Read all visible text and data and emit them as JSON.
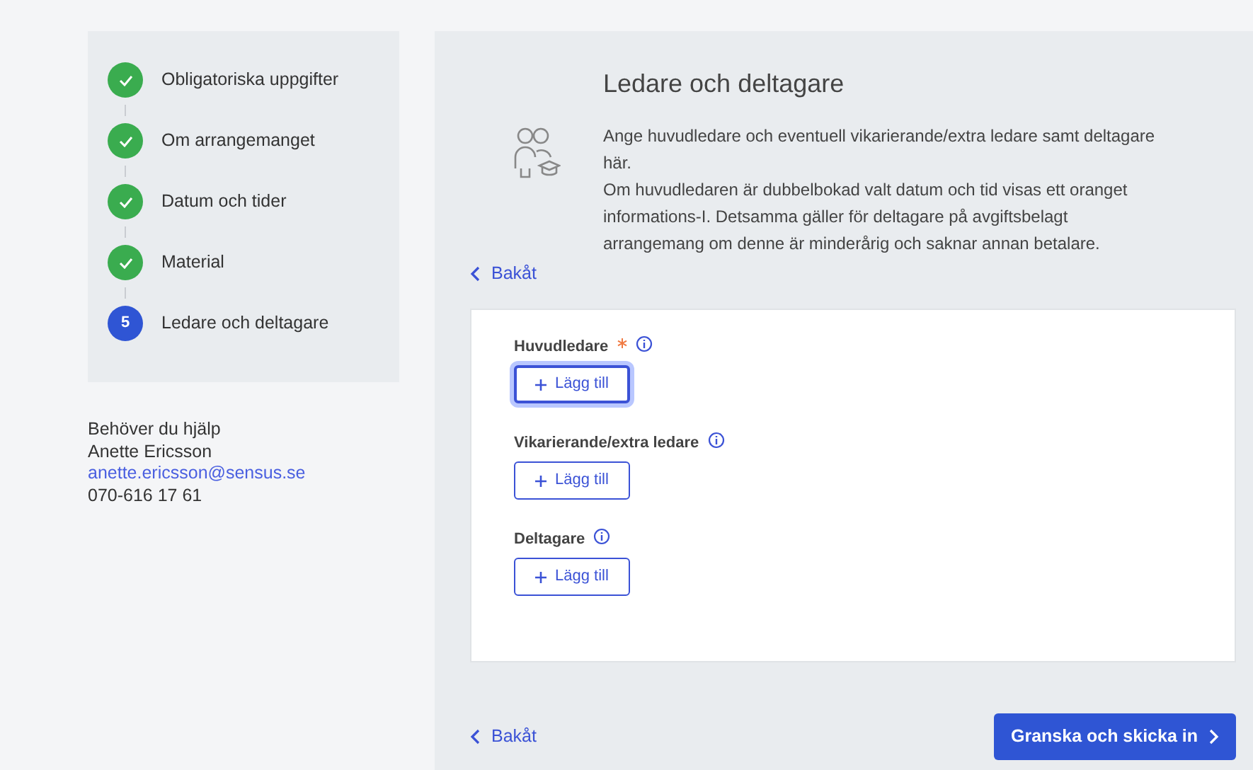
{
  "steps": [
    {
      "label": "Obligatoriska uppgifter",
      "done": true
    },
    {
      "label": "Om arrangemanget",
      "done": true
    },
    {
      "label": "Datum och tider",
      "done": true
    },
    {
      "label": "Material",
      "done": true
    },
    {
      "label": "Ledare och deltagare",
      "done": false,
      "number": "5"
    }
  ],
  "help": {
    "title": "Behöver du hjälp",
    "name": "Anette Ericsson",
    "email": "anette.ericsson@sensus.se",
    "phone": "070-616 17 61"
  },
  "section": {
    "title": "Ledare och deltagare",
    "paragraphs": [
      "Ange huvudledare och eventuell vikarierande/extra ledare samt deltagare här.",
      "Om huvudledaren är dubbelbokad valt datum och tid visas ett oranget informations-I. Detsamma gäller för deltagare på avgiftsbelagt arrangemang om denne är minderårig och saknar annan betalare."
    ]
  },
  "back_top": "Bakåt",
  "groups": [
    {
      "label": "Huvudledare",
      "required": true,
      "button": "Lägg till",
      "focused": true
    },
    {
      "label": "Vikarierande/extra ledare",
      "required": false,
      "button": "Lägg till",
      "focused": false
    },
    {
      "label": "Deltagare",
      "required": false,
      "button": "Lägg till",
      "focused": false
    }
  ],
  "footer": {
    "back": "Bakåt",
    "submit": "Granska och skicka in"
  }
}
